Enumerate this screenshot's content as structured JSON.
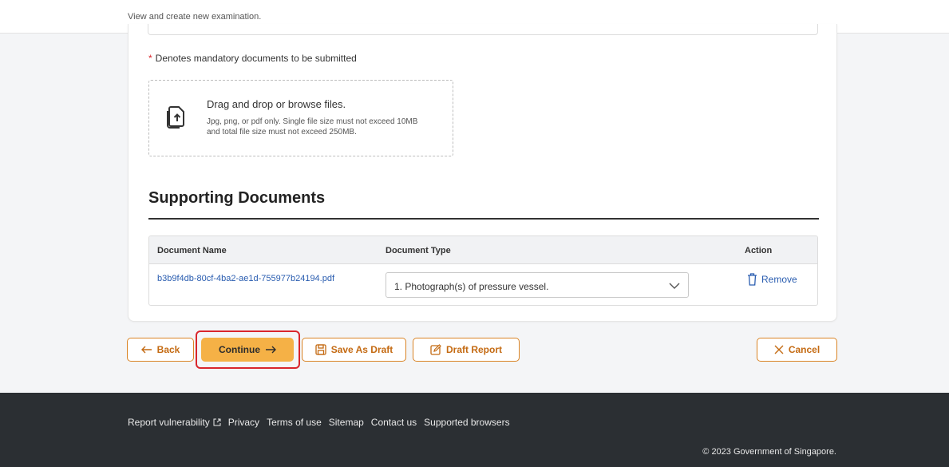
{
  "header": {
    "subtitle": "View and create new examination."
  },
  "upload": {
    "mandatory_star": "*",
    "mandatory_note": "Denotes mandatory documents to be submitted",
    "dropzone_title": "Drag and drop or browse files.",
    "dropzone_hint": "Jpg, png, or pdf only. Single file size must not exceed 10MB and total file size must not exceed 250MB.",
    "icon": "file-upload-icon"
  },
  "supporting_documents": {
    "title": "Supporting Documents",
    "columns": [
      "Document Name",
      "Document Type",
      "Action"
    ],
    "rows": [
      {
        "document_name": "b3b9f4db-80cf-4ba2-ae1d-755977b24194.pdf",
        "document_type": "1. Photograph(s) of pressure vessel.",
        "action": "Remove"
      }
    ]
  },
  "actions": {
    "back": "Back",
    "continue": "Continue",
    "save_draft": "Save As Draft",
    "draft_report": "Draft Report",
    "cancel": "Cancel"
  },
  "footer": {
    "links": [
      "Report vulnerability",
      "Privacy",
      "Terms of use",
      "Sitemap",
      "Contact us",
      "Supported browsers"
    ],
    "copyright": "© 2023 Government of Singapore."
  },
  "colors": {
    "accent": "#f5b146",
    "accent_border": "#d98324",
    "link": "#2a5db0",
    "highlight": "#d9262c",
    "footer_bg": "#2b2f33"
  }
}
